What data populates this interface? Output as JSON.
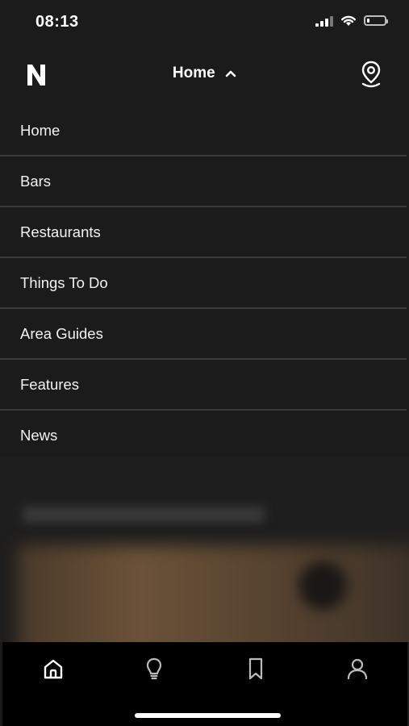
{
  "status_bar": {
    "time": "08:13",
    "battery_level": 0.15
  },
  "header": {
    "logo_icon": "the-n-logo",
    "title": "Home",
    "title_toggle_icon": "chevron-up-icon",
    "location_icon": "map-pin-icon"
  },
  "menu": {
    "items": [
      {
        "label": "Home"
      },
      {
        "label": "Bars"
      },
      {
        "label": "Restaurants"
      },
      {
        "label": "Things To Do"
      },
      {
        "label": "Area Guides"
      },
      {
        "label": "Features"
      },
      {
        "label": "News"
      }
    ]
  },
  "tab_bar": {
    "tabs": [
      {
        "icon": "home-icon",
        "active": true
      },
      {
        "icon": "lightbulb-icon",
        "active": false
      },
      {
        "icon": "bookmark-icon",
        "active": false
      },
      {
        "icon": "profile-icon",
        "active": false
      }
    ]
  },
  "colors": {
    "background": "#1b1b1b",
    "divider": "#3a3a3a",
    "tab_bar": "#000000",
    "text": "#ffffff"
  }
}
